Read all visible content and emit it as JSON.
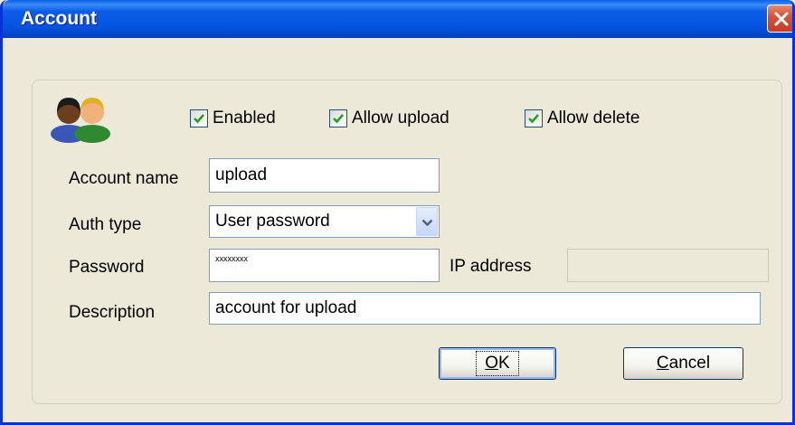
{
  "window": {
    "title": "Account"
  },
  "checkboxes": [
    {
      "label": "Enabled",
      "checked": true
    },
    {
      "label": "Allow upload",
      "checked": true
    },
    {
      "label": "Allow delete",
      "checked": true
    }
  ],
  "fields": {
    "account_name": {
      "label": "Account name",
      "value": "upload"
    },
    "auth_type": {
      "label": "Auth type",
      "value": "User password"
    },
    "password": {
      "label": "Password",
      "value": "xxxxxxxx"
    },
    "ip_address": {
      "label": "IP address",
      "value": ""
    },
    "description": {
      "label": "Description",
      "value": "account for upload"
    }
  },
  "buttons": {
    "ok": {
      "mnemonic": "O",
      "rest": "K"
    },
    "cancel": {
      "mnemonic": "C",
      "rest": "ancel"
    }
  },
  "colors": {
    "titlebar": "#0554e0",
    "close": "#c43d22",
    "dialog_bg": "#ece9d8",
    "checkmark": "#21a121"
  },
  "icons": {
    "users": "users-icon",
    "close": "close-icon",
    "dropdown": "chevron-down-icon"
  }
}
